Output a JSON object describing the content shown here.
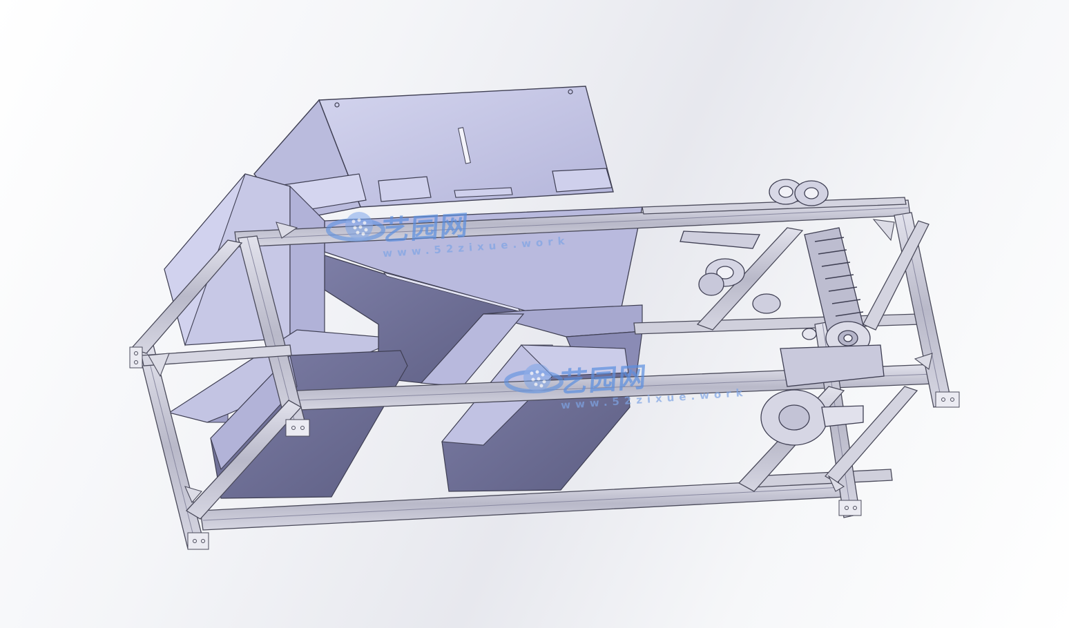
{
  "watermark": {
    "brand": "艺园网",
    "url": "www.52zixue.work",
    "color": "#5b8fe0"
  },
  "colors": {
    "frame": "#c4c4d2",
    "frame_edge": "#4a4a5a",
    "panel_light": "#c6c7e4",
    "panel_mid": "#a9aad0",
    "panel_dark": "#6c6d92",
    "background": "#ececf1"
  },
  "icons": [
    "globe-logo-icon"
  ]
}
